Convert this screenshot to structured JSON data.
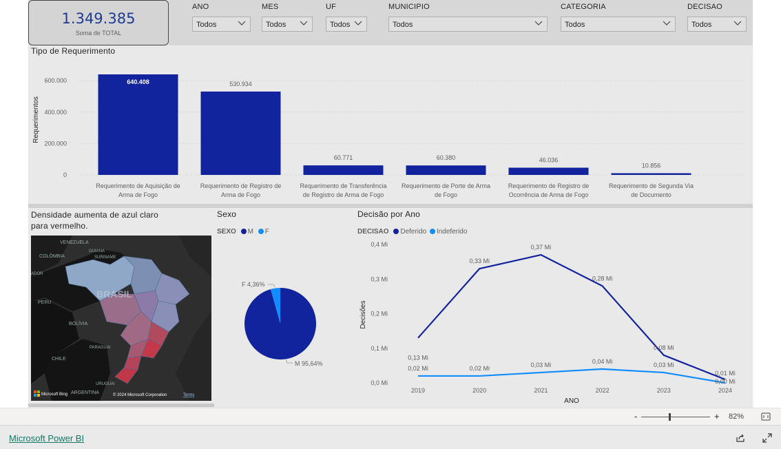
{
  "kpi": {
    "value": "1.349.385",
    "caption": "Soma de TOTAL"
  },
  "filters": [
    {
      "label": "ANO",
      "value": "Todos"
    },
    {
      "label": "MES",
      "value": "Todos"
    },
    {
      "label": "UF",
      "value": "Todos"
    },
    {
      "label": "MUNICIPIO",
      "value": "Todos"
    },
    {
      "label": "CATEGORIA",
      "value": "Todos"
    },
    {
      "label": "DECISAO",
      "value": "Todos"
    }
  ],
  "bar_section": {
    "title": "Tipo de Requerimento"
  },
  "map_section": {
    "title_line1": "Densidade aumenta de azul claro",
    "title_line2": "para vermelho.",
    "labels": {
      "country": "BRASIL",
      "venezuela": "VENEZUELA",
      "guiana": "GUIANA",
      "suriname": "SURINAME",
      "colombia": "COLÔMBIA",
      "ador": "ADOR",
      "peru": "PERU",
      "bolivia": "BOLÍVIA",
      "paraguai": "PARAGUAI",
      "chile": "CHILE",
      "uruguai": "URUGUAI",
      "argentina": "ARGENTINA"
    },
    "attribution": "Microsoft Bing",
    "copyright": "© 2024 Microsoft Corporation",
    "terms": "Terms"
  },
  "pie_section": {
    "title": "Sexo",
    "legend_title": "SEXO"
  },
  "line_section": {
    "title": "Decisão por Ano",
    "legend_title": "DECISAO"
  },
  "colors": {
    "dark_blue": "#12239e",
    "light_blue": "#118dff",
    "background": "#e9e9e9",
    "kpi_value": "#1f3a93",
    "power_bi_link": "#117865"
  },
  "chart_data": [
    {
      "type": "bar",
      "title": "Tipo de Requerimento",
      "ylabel": "Requerimentos",
      "xlabel": "",
      "ylim": [
        0,
        640408
      ],
      "yticks": [
        "0",
        "200.000",
        "400.000",
        "600.000"
      ],
      "ytick_values": [
        0,
        200000,
        400000,
        600000
      ],
      "categories": [
        [
          "Requerimento de Aquisição de",
          "Arma de Fogo"
        ],
        [
          "Requerimento de Registro de",
          "Arma de Fogo"
        ],
        [
          "Requerimento de Transferência",
          "de Registro de Arma de Fogo"
        ],
        [
          "Requerimento de Porte de Arma",
          "de Fogo"
        ],
        [
          "Requerimento de Registro de",
          "Ocorrência de Arma de Fogo"
        ],
        [
          "Requerimento de Segunda Via",
          "de Documento"
        ]
      ],
      "values": [
        640408,
        530934,
        60771,
        60380,
        46036,
        10856
      ],
      "data_labels": [
        "640.408",
        "530.934",
        "60.771",
        "60.380",
        "46.036",
        "10.856"
      ],
      "grid": true
    },
    {
      "type": "pie",
      "title": "Sexo",
      "legend_title": "SEXO",
      "labels": [
        "M",
        "F"
      ],
      "values": [
        95.64,
        4.36
      ],
      "data_labels": [
        "M 95,64%",
        "F 4,36%"
      ]
    },
    {
      "type": "line",
      "title": "Decisão por Ano",
      "xlabel": "ANO",
      "ylabel": "Decisões",
      "legend_title": "DECISAO",
      "x": [
        "2019",
        "2020",
        "2021",
        "2022",
        "2023",
        "2024"
      ],
      "ylim": [
        0,
        0.4
      ],
      "yticks": [
        "0,0 Mi",
        "0,1 Mi",
        "0,2 Mi",
        "0,3 Mi",
        "0,4 Mi"
      ],
      "ytick_values": [
        0,
        0.1,
        0.2,
        0.3,
        0.4
      ],
      "series": [
        {
          "name": "Deferido",
          "values": [
            0.13,
            0.33,
            0.37,
            0.28,
            0.08,
            0.01
          ],
          "labels": [
            "0,13 Mi",
            "0,33 Mi",
            "0,37 Mi",
            "0,28 Mi",
            "0,08 Mi",
            "0,01 Mi"
          ]
        },
        {
          "name": "Indeferido",
          "values": [
            0.02,
            0.02,
            0.03,
            0.04,
            0.03,
            0.0
          ],
          "labels": [
            "0,02 Mi",
            "0,02 Mi",
            "0,03 Mi",
            "0,04 Mi",
            "0,03 Mi",
            "0,00 Mi"
          ]
        }
      ]
    }
  ],
  "zoom": {
    "minus": "-",
    "plus": "+",
    "level": "82%",
    "level_fraction": 0.82
  },
  "footer": {
    "brand_link": "Microsoft Power BI"
  }
}
